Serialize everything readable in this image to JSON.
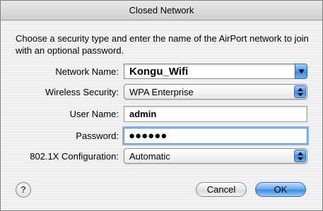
{
  "window": {
    "title": "Closed Network"
  },
  "instructions": "Choose a security type and enter the name of the AirPort network to join with an optional password.",
  "form": {
    "network_name": {
      "label": "Network Name:",
      "value": "Kongu_Wifi"
    },
    "wireless_security": {
      "label": "Wireless Security:",
      "value": "WPA Enterprise"
    },
    "user_name": {
      "label": "User Name:",
      "value": "admin"
    },
    "password": {
      "label": "Password:",
      "masked_value": "●●●●●●"
    },
    "config_8021x": {
      "label": "802.1X Configuration:",
      "value": "Automatic"
    }
  },
  "buttons": {
    "help": "?",
    "cancel": "Cancel",
    "ok": "OK"
  },
  "colors": {
    "accent": "#3d8be0",
    "focus_ring": "#8db8ea",
    "help_glyph": "#6b2a90"
  }
}
